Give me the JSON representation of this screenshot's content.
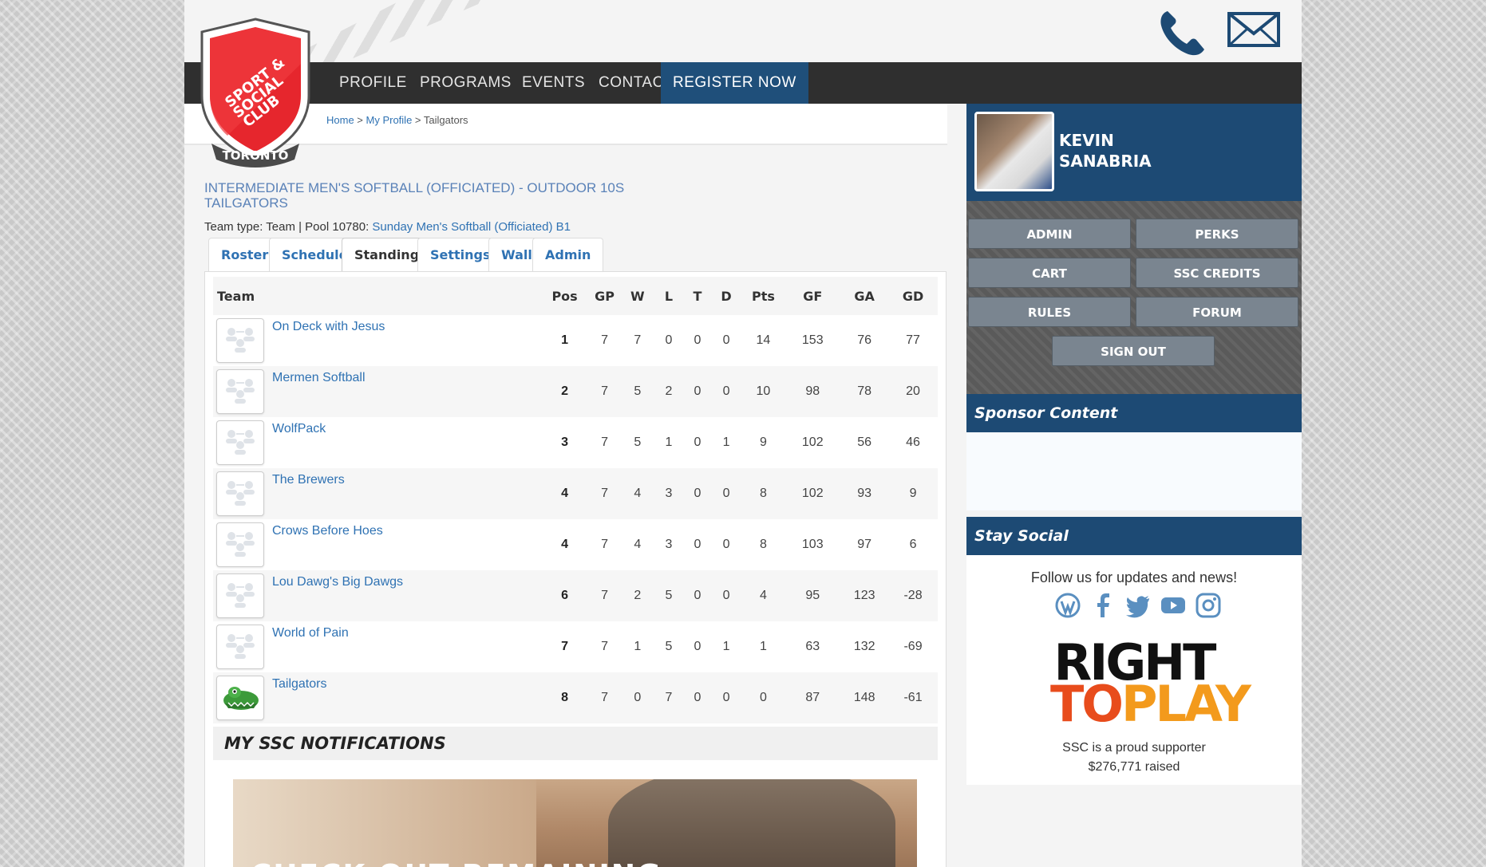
{
  "nav": {
    "items": [
      "PROFILE",
      "PROGRAMS",
      "EVENTS",
      "CONTACT",
      "REGISTER NOW"
    ]
  },
  "logo": {
    "lines": [
      "SPORT &",
      "SOCIAL",
      "CLUB"
    ],
    "city": "TORONTO"
  },
  "breadcrumb": {
    "home": "Home",
    "sep1": " > ",
    "profile": "My Profile",
    "sep2": " > ",
    "current": "Tailgators"
  },
  "team": {
    "title_line1": "INTERMEDIATE MEN'S SOFTBALL (OFFICIATED) - OUTDOOR 10S",
    "title_line2": "TAILGATORS",
    "info_prefix": "Team type: Team | Pool 10780: ",
    "pool_link": "Sunday Men's Softball (Officiated) B1"
  },
  "tabs": [
    "Roster",
    "Schedule",
    "Standings",
    "Settings",
    "Wall",
    "Admin"
  ],
  "standings": {
    "headers": [
      "Team",
      "Pos",
      "GP",
      "W",
      "L",
      "T",
      "D",
      "Pts",
      "GF",
      "GA",
      "GD"
    ],
    "rows": [
      [
        "On Deck with Jesus",
        "1",
        "7",
        "7",
        "0",
        "0",
        "0",
        "14",
        "153",
        "76",
        "77"
      ],
      [
        "Mermen Softball",
        "2",
        "7",
        "5",
        "2",
        "0",
        "0",
        "10",
        "98",
        "78",
        "20"
      ],
      [
        "WolfPack",
        "3",
        "7",
        "5",
        "1",
        "0",
        "1",
        "9",
        "102",
        "56",
        "46"
      ],
      [
        "The Brewers",
        "4",
        "7",
        "4",
        "3",
        "0",
        "0",
        "8",
        "102",
        "93",
        "9"
      ],
      [
        "Crows Before Hoes",
        "4",
        "7",
        "4",
        "3",
        "0",
        "0",
        "8",
        "103",
        "97",
        "6"
      ],
      [
        "Lou Dawg's Big Dawgs",
        "6",
        "7",
        "2",
        "5",
        "0",
        "0",
        "4",
        "95",
        "123",
        "-28"
      ],
      [
        "World of Pain",
        "7",
        "7",
        "1",
        "5",
        "0",
        "1",
        "1",
        "63",
        "132",
        "-69"
      ],
      [
        "Tailgators",
        "8",
        "7",
        "0",
        "7",
        "0",
        "0",
        "0",
        "87",
        "148",
        "-61"
      ]
    ]
  },
  "notifications": {
    "title": "MY SSC NOTIFICATIONS",
    "banner_text": "CHECK OUT REMAINING"
  },
  "profile": {
    "first": "KEVIN",
    "last": "SANABRIA"
  },
  "sidebar_buttons": [
    "ADMIN",
    "PERKS",
    "CART",
    "SSC CREDITS",
    "RULES",
    "FORUM",
    "SIGN OUT"
  ],
  "sponsor": {
    "title": "Sponsor Content"
  },
  "social": {
    "title": "Stay Social",
    "follow": "Follow us for updates and news!",
    "icons": [
      "wordpress-icon",
      "facebook-icon",
      "twitter-icon",
      "youtube-icon",
      "instagram-icon"
    ]
  },
  "charity": {
    "line1": "RIGHT",
    "line2a": "TO",
    "line2b": "PLAY",
    "supporter": "SSC is a proud supporter",
    "raised": "$276,771 raised"
  }
}
